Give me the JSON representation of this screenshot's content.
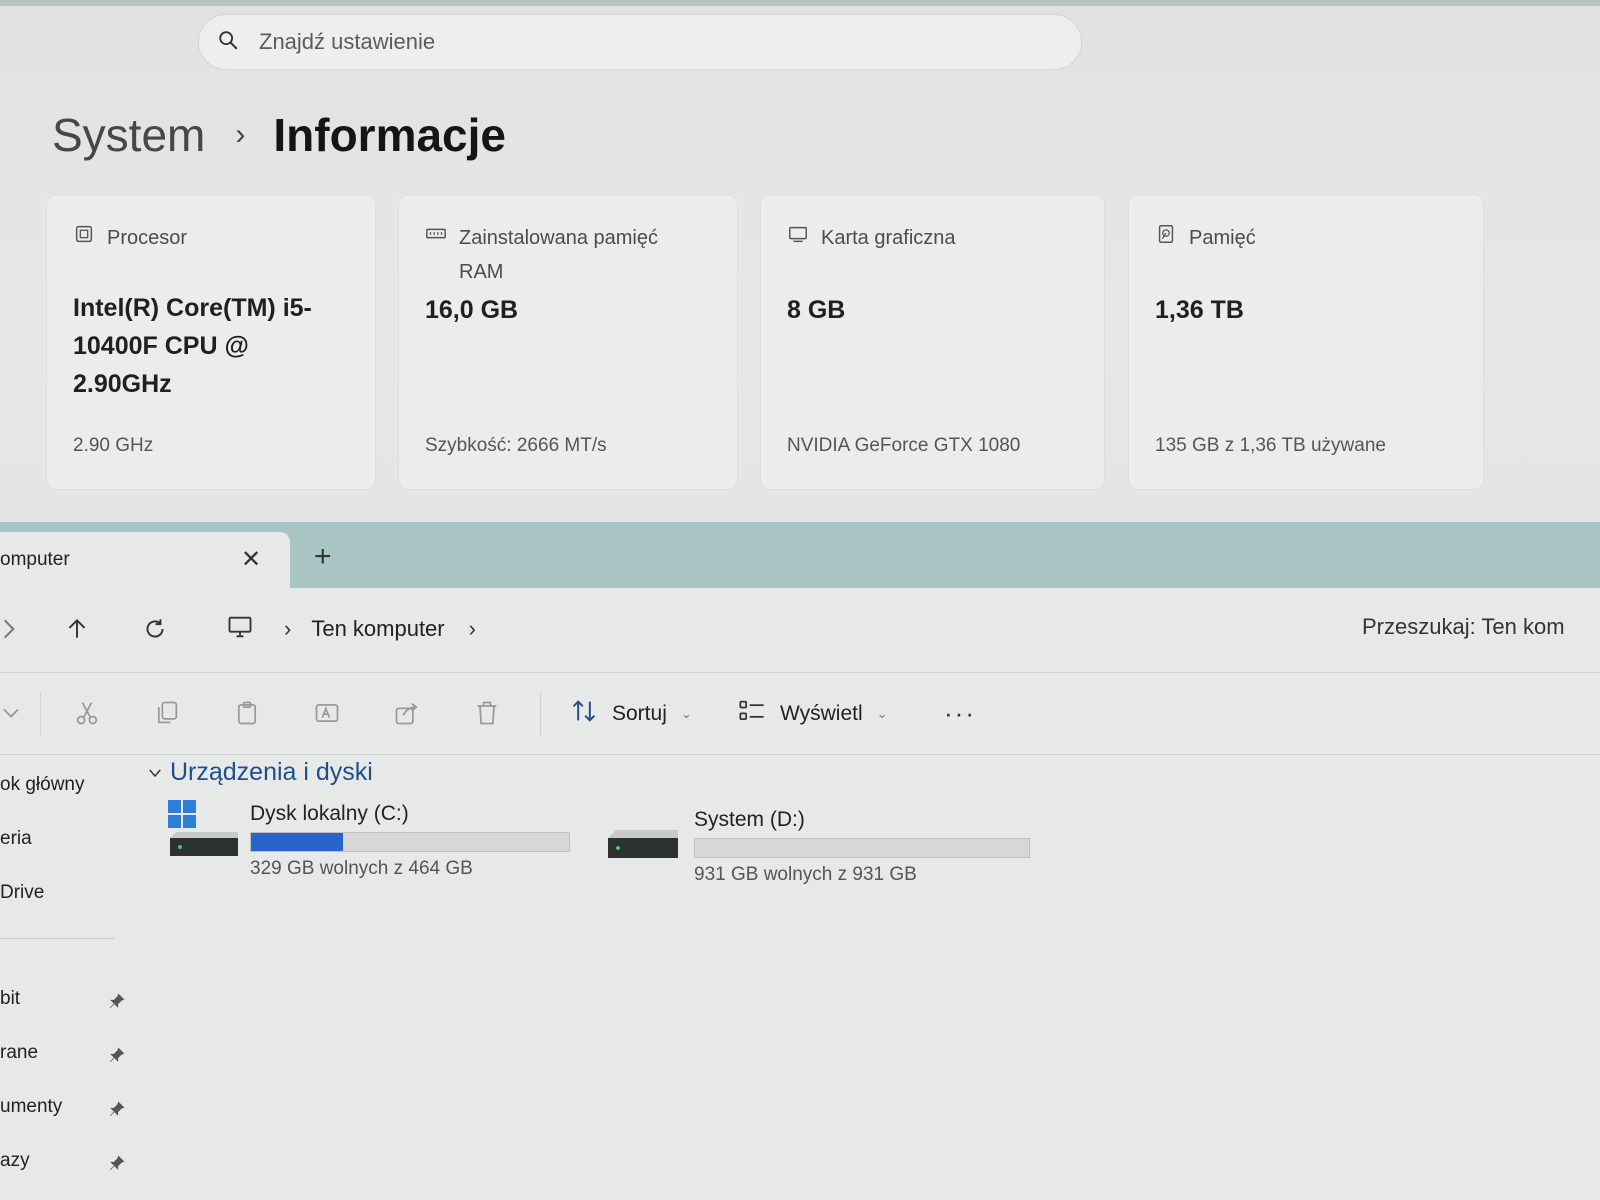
{
  "settings": {
    "search_placeholder": "Znajdź ustawienie",
    "breadcrumb": {
      "parent": "System",
      "separator": "›",
      "current": "Informacje"
    },
    "cards": [
      {
        "icon": "cpu-icon",
        "label": "Procesor",
        "value": "Intel(R) Core(TM) i5-10400F CPU @ 2.90GHz",
        "sub": "2.90 GHz"
      },
      {
        "icon": "ram-icon",
        "label": "Zainstalowana pamięć RAM",
        "value": "16,0 GB",
        "sub": "Szybkość: 2666 MT/s"
      },
      {
        "icon": "gpu-icon",
        "label": "Karta graficzna",
        "value": "8 GB",
        "sub": "NVIDIA GeForce GTX 1080"
      },
      {
        "icon": "storage-icon",
        "label": "Pamięć",
        "value": "1,36 TB",
        "sub": "135 GB z 1,36 TB używane"
      }
    ]
  },
  "explorer": {
    "tab_title": "omputer",
    "tab_close": "✕",
    "tab_add": "+",
    "address": {
      "location": "Ten komputer"
    },
    "search_placeholder": "Przeszukaj: Ten kom",
    "toolbar": {
      "sort_label": "Sortuj",
      "view_label": "Wyświetl",
      "more_label": "···"
    },
    "sidebar": {
      "items": [
        "ok główny",
        "eria",
        "Drive"
      ],
      "pinned": [
        "bit",
        "rane",
        "umenty",
        "azy"
      ]
    },
    "section_title": "Urządzenia i dyski",
    "drives": [
      {
        "name": "Dysk lokalny (C:)",
        "free_text": "329 GB wolnych z 464 GB",
        "used_fraction": 0.29,
        "icon": "windows-drive-icon"
      },
      {
        "name": "System (D:)",
        "free_text": "931 GB wolnych z 931 GB",
        "used_fraction": 0.0,
        "icon": "hard-drive-icon"
      }
    ],
    "accent_color": "#2a63c9"
  }
}
